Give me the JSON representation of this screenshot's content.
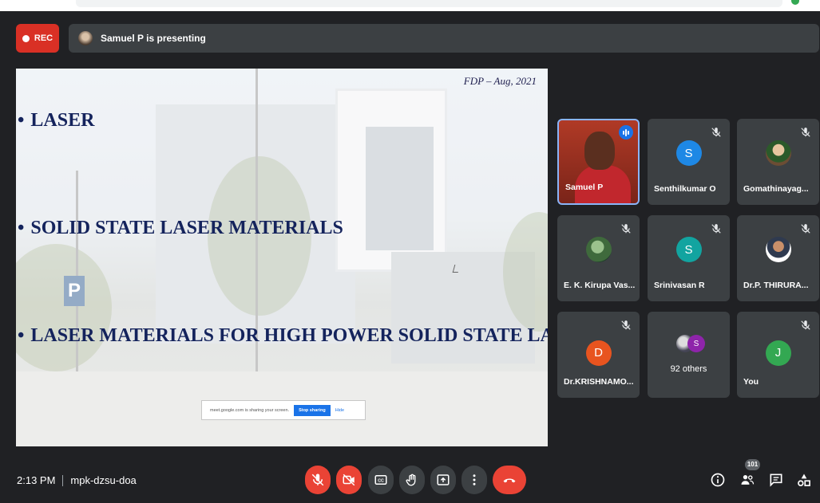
{
  "recording": {
    "label": "REC"
  },
  "presenter_bar": {
    "text": "Samuel P is presenting"
  },
  "slide": {
    "header": "FDP – Aug, 2021",
    "bullets": [
      "LASER",
      "SOLID STATE LASER MATERIALS",
      "LASER MATERIALS FOR HIGH POWER SOLID STATE LASERS"
    ],
    "bullet_char": "•",
    "share_notice": {
      "text": "meet.google.com is sharing your screen.",
      "stop_label": "Stop sharing",
      "hide_label": "Hide"
    }
  },
  "participants": [
    {
      "name": "Samuel P",
      "featured": true,
      "speaking": true
    },
    {
      "name": "Senthilkumar O",
      "initial": "S",
      "color": "#1e88e5",
      "muted": true
    },
    {
      "name": "Gomathinayag...",
      "photo": true,
      "muted": true
    },
    {
      "name": "E. K. Kirupa Vas...",
      "photo": true,
      "muted": true
    },
    {
      "name": "Srinivasan R",
      "initial": "S",
      "color": "#12a4a0",
      "muted": true
    },
    {
      "name": "Dr.P. THIRURA...",
      "photo": true,
      "muted": true
    },
    {
      "name": "Dr.KRISHNAMO...",
      "initial": "D",
      "color": "#e8541f",
      "muted": true
    },
    {
      "label": "92 others",
      "avatar_initial": "S"
    },
    {
      "name": "You",
      "initial": "J",
      "color": "#33a852",
      "muted": true
    }
  ],
  "footer": {
    "time": "2:13 PM",
    "meeting_code": "mpk-dzsu-doa",
    "people_count": "101"
  },
  "colors": {
    "danger": "#ea4335",
    "accent": "#1a73e8",
    "tile_bg": "#3c4043",
    "app_bg": "#202124"
  }
}
